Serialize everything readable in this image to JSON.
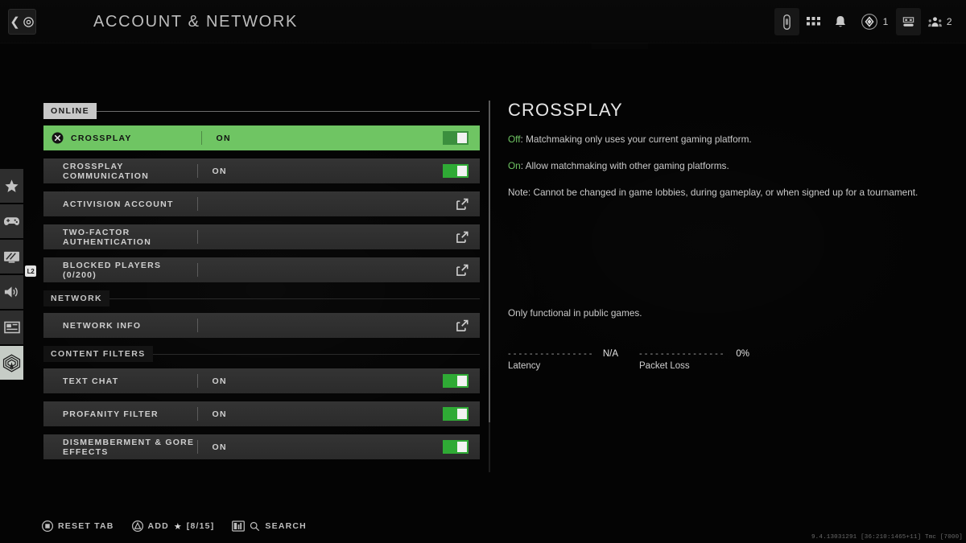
{
  "header": {
    "title": "ACCOUNT & NETWORK",
    "back_button": "back-button",
    "hud": {
      "device_icon": "device-icon",
      "grid_icon": "grid-icon",
      "bell_icon": "bell-icon",
      "rank_icon": "rank-diamond-icon",
      "rank_count": "1",
      "store_icon": "store-icon",
      "party_icon": "party-icon",
      "party_count": "2"
    }
  },
  "rail": {
    "badge": "L2",
    "items": [
      {
        "name": "sidebar-item-favorites",
        "icon": "star-icon",
        "active": false
      },
      {
        "name": "sidebar-item-controller",
        "icon": "gamepad-icon",
        "active": false
      },
      {
        "name": "sidebar-item-graphics",
        "icon": "monitor-icon",
        "active": false
      },
      {
        "name": "sidebar-item-audio",
        "icon": "speaker-icon",
        "active": false
      },
      {
        "name": "sidebar-item-interface",
        "icon": "layout-icon",
        "active": false
      },
      {
        "name": "sidebar-item-account-network",
        "icon": "network-tower-icon",
        "active": true
      }
    ]
  },
  "sections": [
    {
      "title": "ONLINE",
      "style": "light",
      "rows": [
        {
          "label": "CROSSPLAY",
          "value": "ON",
          "control": "toggle",
          "toggle_on": true,
          "selected": true,
          "icon": "cross-button-icon"
        },
        {
          "label": "CROSSPLAY COMMUNICATION",
          "value": "ON",
          "control": "toggle",
          "toggle_on": true,
          "selected": false,
          "icon": ""
        },
        {
          "label": "ACTIVISION ACCOUNT",
          "value": "",
          "control": "external",
          "toggle_on": false,
          "selected": false,
          "icon": ""
        },
        {
          "label": "TWO-FACTOR AUTHENTICATION",
          "value": "",
          "control": "external",
          "toggle_on": false,
          "selected": false,
          "icon": ""
        },
        {
          "label": "BLOCKED PLAYERS (0/200)",
          "value": "",
          "control": "external",
          "toggle_on": false,
          "selected": false,
          "icon": ""
        }
      ]
    },
    {
      "title": "NETWORK",
      "style": "dark",
      "rows": [
        {
          "label": "NETWORK INFO",
          "value": "",
          "control": "external",
          "toggle_on": false,
          "selected": false,
          "icon": ""
        }
      ]
    },
    {
      "title": "CONTENT FILTERS",
      "style": "dark",
      "rows": [
        {
          "label": "TEXT CHAT",
          "value": "ON",
          "control": "toggle",
          "toggle_on": true,
          "selected": false,
          "icon": ""
        },
        {
          "label": "PROFANITY FILTER",
          "value": "ON",
          "control": "toggle",
          "toggle_on": true,
          "selected": false,
          "icon": ""
        },
        {
          "label": "DISMEMBERMENT & GORE EFFECTS",
          "value": "ON",
          "control": "toggle",
          "toggle_on": true,
          "selected": false,
          "icon": ""
        }
      ]
    }
  ],
  "detail": {
    "title": "CROSSPLAY",
    "line_off_key": "Off",
    "line_off_text": ": Matchmaking only uses your current gaming platform.",
    "line_on_key": "On",
    "line_on_text": ": Allow matchmaking with other gaming platforms.",
    "line_note": "Note: Cannot be changed in game lobbies, during gameplay, or when signed up for a tournament.",
    "note_extra": "Only functional in public games.",
    "meters": [
      {
        "label": "Latency",
        "value": "N/A",
        "dashes": "- - - - - - - - - - - - - - - -"
      },
      {
        "label": "Packet Loss",
        "value": "0%",
        "dashes": "- - - - - - - - - - - - - - - -"
      }
    ]
  },
  "footer": {
    "buttons": [
      {
        "name": "reset-tab-button",
        "icon": "square-button-icon",
        "label": "RESET TAB",
        "star": false,
        "count": ""
      },
      {
        "name": "add-favorite-button",
        "icon": "triangle-button-icon",
        "label": "ADD",
        "star": true,
        "count": "[8/15]"
      },
      {
        "name": "search-button",
        "icon": "touchpad-icon",
        "label": "SEARCH",
        "star": false,
        "count": ""
      }
    ]
  },
  "version": "9.4.13031291 [36:210:1465+11] Tmc [7000]",
  "colors": {
    "accent_green": "#6fc563",
    "toggle_green": "#2faa35",
    "chip_light": "#c8c8c8"
  }
}
